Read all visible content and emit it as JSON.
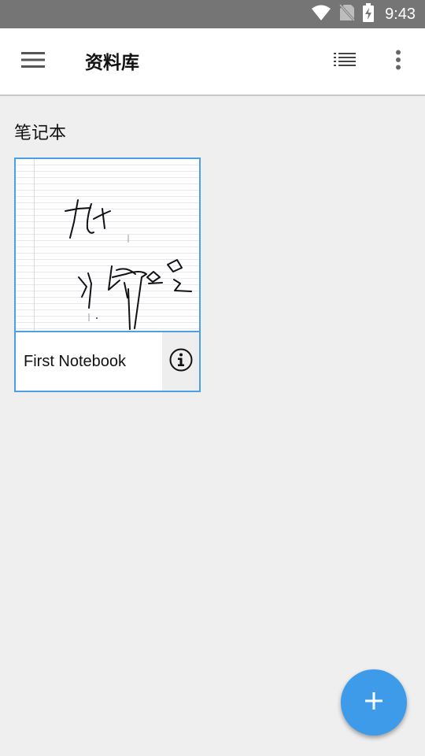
{
  "status_bar": {
    "time": "9:43",
    "icons": [
      "wifi-icon",
      "no-sim-icon",
      "battery-charging-icon"
    ]
  },
  "app_bar": {
    "title": "资料库",
    "menu_icon": "hamburger-menu-icon",
    "list_view_icon": "list-view-icon",
    "more_icon": "more-vert-icon"
  },
  "section": {
    "title": "笔记本"
  },
  "notebooks": [
    {
      "name": "First Notebook",
      "info_icon": "info-icon"
    }
  ],
  "fab": {
    "icon": "add-icon"
  },
  "colors": {
    "status_bar": "#757575",
    "app_bar": "#ffffff",
    "background": "#efefef",
    "accent": "#3d9be9",
    "card_border": "#4a9fe6"
  }
}
